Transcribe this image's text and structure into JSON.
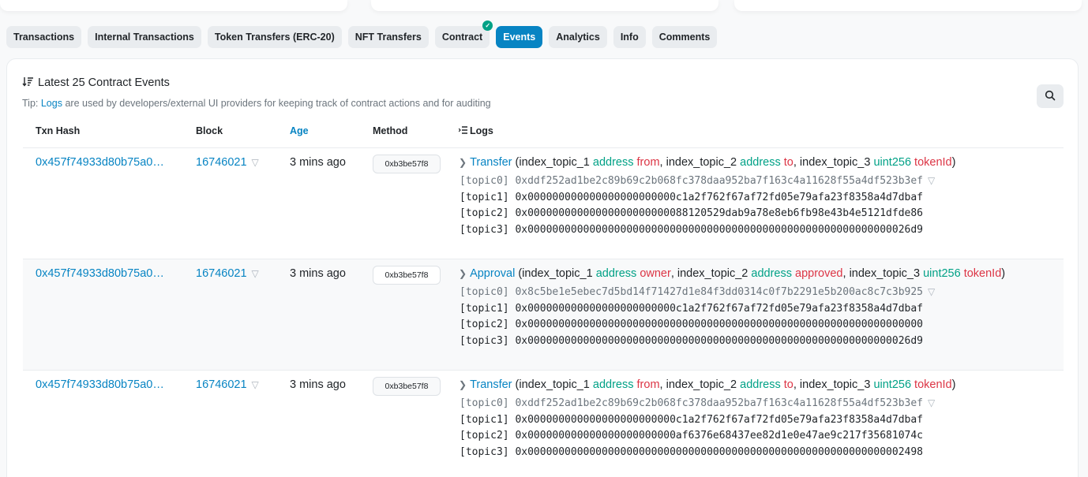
{
  "tabs": [
    {
      "label": "Transactions",
      "active": false,
      "verified": false
    },
    {
      "label": "Internal Transactions",
      "active": false,
      "verified": false
    },
    {
      "label": "Token Transfers (ERC-20)",
      "active": false,
      "verified": false
    },
    {
      "label": "NFT Transfers",
      "active": false,
      "verified": false
    },
    {
      "label": "Contract",
      "active": false,
      "verified": true
    },
    {
      "label": "Events",
      "active": true,
      "verified": false
    },
    {
      "label": "Analytics",
      "active": false,
      "verified": false
    },
    {
      "label": "Info",
      "active": false,
      "verified": false
    },
    {
      "label": "Comments",
      "active": false,
      "verified": false
    }
  ],
  "card": {
    "title": "Latest 25 Contract Events",
    "tip_prefix": "Tip:",
    "tip_link": "Logs",
    "tip_suffix": "are used by developers/external UI providers for keeping track of contract actions and for auditing"
  },
  "columns": {
    "txn_hash": "Txn Hash",
    "block": "Block",
    "age": "Age",
    "method": "Method",
    "logs": "Logs"
  },
  "rows": [
    {
      "txn_hash": "0x457f74933d80b75a0…",
      "block": "16746021",
      "age": "3 mins ago",
      "method": "0xb3be57f8",
      "event": "Transfer",
      "params": [
        {
          "idx": "index_topic_1",
          "type": "address",
          "name": "from"
        },
        {
          "idx": "index_topic_2",
          "type": "address",
          "name": "to"
        },
        {
          "idx": "index_topic_3",
          "type": "uint256",
          "name": "tokenId"
        }
      ],
      "topics": [
        "[topic0] 0xddf252ad1be2c89b69c2b068fc378daa952ba7f163c4a11628f55a4df523b3ef",
        "[topic1] 0x000000000000000000000000c1a2f762f67af72fd05e79afa23f8358a4d7dbaf",
        "[topic2] 0x00000000000000000000000088120529dab9a78e8eb6fb98e43b4e5121dfde86",
        "[topic3] 0x00000000000000000000000000000000000000000000000000000000000026d9"
      ]
    },
    {
      "txn_hash": "0x457f74933d80b75a0…",
      "block": "16746021",
      "age": "3 mins ago",
      "method": "0xb3be57f8",
      "event": "Approval",
      "params": [
        {
          "idx": "index_topic_1",
          "type": "address",
          "name": "owner"
        },
        {
          "idx": "index_topic_2",
          "type": "address",
          "name": "approved"
        },
        {
          "idx": "index_topic_3",
          "type": "uint256",
          "name": "tokenId"
        }
      ],
      "topics": [
        "[topic0] 0x8c5be1e5ebec7d5bd14f71427d1e84f3dd0314c0f7b2291e5b200ac8c7c3b925",
        "[topic1] 0x000000000000000000000000c1a2f762f67af72fd05e79afa23f8358a4d7dbaf",
        "[topic2] 0x0000000000000000000000000000000000000000000000000000000000000000",
        "[topic3] 0x00000000000000000000000000000000000000000000000000000000000026d9"
      ]
    },
    {
      "txn_hash": "0x457f74933d80b75a0…",
      "block": "16746021",
      "age": "3 mins ago",
      "method": "0xb3be57f8",
      "event": "Transfer",
      "params": [
        {
          "idx": "index_topic_1",
          "type": "address",
          "name": "from"
        },
        {
          "idx": "index_topic_2",
          "type": "address",
          "name": "to"
        },
        {
          "idx": "index_topic_3",
          "type": "uint256",
          "name": "tokenId"
        }
      ],
      "topics": [
        "[topic0] 0xddf252ad1be2c89b69c2b068fc378daa952ba7f163c4a11628f55a4df523b3ef",
        "[topic1] 0x000000000000000000000000c1a2f762f67af72fd05e79afa23f8358a4d7dbaf",
        "[topic2] 0x000000000000000000000000af6376e68437ee82d1e0e47ae9c217f35681074c",
        "[topic3] 0x0000000000000000000000000000000000000000000000000000000000002498"
      ]
    }
  ],
  "colors": {
    "accent": "#0784c3",
    "type_green": "#00a186",
    "name_red": "#dc3545"
  }
}
